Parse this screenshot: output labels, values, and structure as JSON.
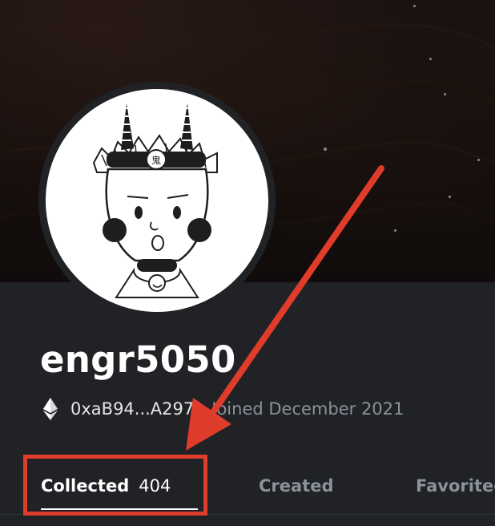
{
  "profile": {
    "username": "engr5050",
    "address": "0xaB94...A297",
    "joined": "Joined December 2021"
  },
  "tabs": [
    {
      "label": "Collected",
      "count": "404",
      "active": true
    },
    {
      "label": "Created"
    },
    {
      "label": "Favorited"
    }
  ],
  "colors": {
    "annotation": "#e03c2b",
    "panel_bg": "#202225",
    "banner_bg": "#140e0c",
    "muted_text": "#8a939b"
  },
  "icons": [
    "ethereum-icon",
    "red-arrow-annotation"
  ]
}
